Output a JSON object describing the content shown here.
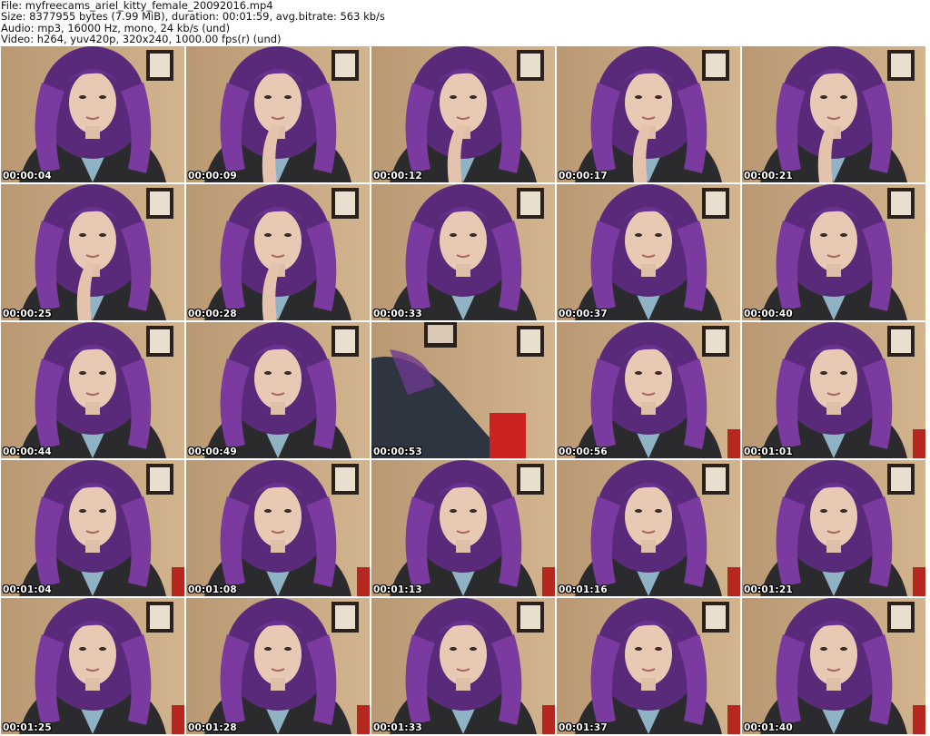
{
  "header": {
    "file_line": "File: myfreecams_ariel_kitty_female_20092016.mp4",
    "size_line": "Size: 8377955 bytes (7.99 MiB), duration: 00:01:59, avg.bitrate: 563 kb/s",
    "audio_line": "Audio: mp3, 16000 Hz, mono, 24 kb/s (und)",
    "video_line": "Video: h264, yuv420p, 320x240, 1000.00 fps(r) (und)"
  },
  "thumbnails": [
    {
      "timestamp": "00:00:04"
    },
    {
      "timestamp": "00:00:09"
    },
    {
      "timestamp": "00:00:12"
    },
    {
      "timestamp": "00:00:17"
    },
    {
      "timestamp": "00:00:21"
    },
    {
      "timestamp": "00:00:25"
    },
    {
      "timestamp": "00:00:28"
    },
    {
      "timestamp": "00:00:33"
    },
    {
      "timestamp": "00:00:37"
    },
    {
      "timestamp": "00:00:40"
    },
    {
      "timestamp": "00:00:44"
    },
    {
      "timestamp": "00:00:49"
    },
    {
      "timestamp": "00:00:53"
    },
    {
      "timestamp": "00:00:56"
    },
    {
      "timestamp": "00:01:01"
    },
    {
      "timestamp": "00:01:04"
    },
    {
      "timestamp": "00:01:08"
    },
    {
      "timestamp": "00:01:13"
    },
    {
      "timestamp": "00:01:16"
    },
    {
      "timestamp": "00:01:21"
    },
    {
      "timestamp": "00:01:25"
    },
    {
      "timestamp": "00:01:28"
    },
    {
      "timestamp": "00:01:33"
    },
    {
      "timestamp": "00:01:37"
    },
    {
      "timestamp": "00:01:40"
    }
  ]
}
